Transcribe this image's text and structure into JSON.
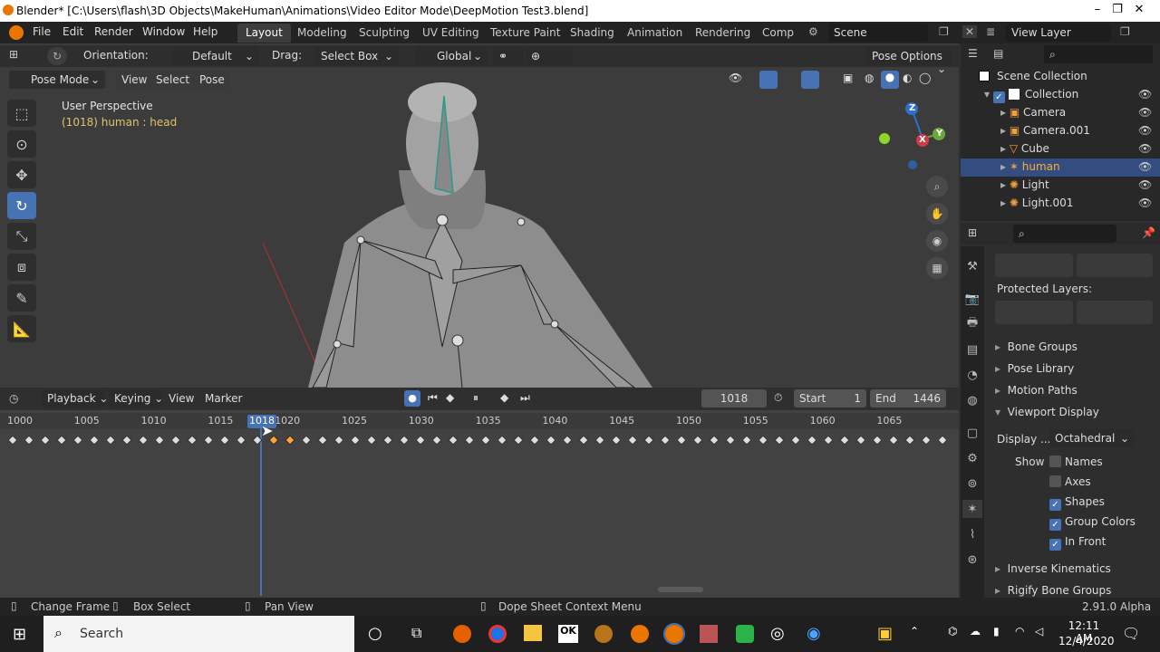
{
  "title": "Blender* [C:\\Users\\flash\\3D Objects\\MakeHuman\\Animations\\Video Editor Mode\\DeepMotion Test3.blend]",
  "window_controls": {
    "minimize": "–",
    "maximize": "❐",
    "close": "✕"
  },
  "menu": [
    "File",
    "Edit",
    "Render",
    "Window",
    "Help"
  ],
  "workspaces": [
    "Layout",
    "Modeling",
    "Sculpting",
    "UV Editing",
    "Texture Paint",
    "Shading",
    "Animation",
    "Rendering",
    "Comp"
  ],
  "scene": "Scene",
  "view_layer": "View Layer",
  "header": {
    "orientation_label": "Orientation:",
    "orientation": "Default",
    "drag_label": "Drag:",
    "drag": "Select Box",
    "transform": "Global",
    "pose_options": "Pose Options"
  },
  "viewport_header": {
    "mode": "Pose Mode",
    "view": "View",
    "select": "Select",
    "pose": "Pose"
  },
  "viewport": {
    "perspective": "User Perspective",
    "object": "(1018) human : head"
  },
  "gizmo": {
    "x": "X",
    "y": "Y",
    "z": "Z"
  },
  "timeline": {
    "playback": "Playback",
    "keying": "Keying",
    "view": "View",
    "marker": "Marker",
    "current_frame": "1018",
    "start_label": "Start",
    "start": "1",
    "end_label": "End",
    "end": "1446",
    "ticks": [
      "1000",
      "1005",
      "1010",
      "1015",
      "1020",
      "1025",
      "1030",
      "1035",
      "1040",
      "1045",
      "1050",
      "1055",
      "1060",
      "1065"
    ],
    "playhead": "1018"
  },
  "status": {
    "change_frame": "Change Frame",
    "box_select": "Box Select",
    "pan_view": "Pan View",
    "context_menu": "Dope Sheet Context Menu",
    "version": "2.91.0 Alpha"
  },
  "outliner": {
    "scene_collection": "Scene Collection",
    "collection": "Collection",
    "items": [
      "Camera",
      "Camera.001",
      "Cube",
      "human",
      "Light",
      "Light.001"
    ]
  },
  "properties": {
    "protected_layers": "Protected Layers:",
    "bone_groups": "Bone Groups",
    "pose_library": "Pose Library",
    "motion_paths": "Motion Paths",
    "viewport_display": "Viewport Display",
    "display_as_label": "Display ...",
    "display_as": "Octahedral",
    "show_label": "Show",
    "names": "Names",
    "axes": "Axes",
    "shapes": "Shapes",
    "group_colors": "Group Colors",
    "in_front": "In Front",
    "inverse_kinematics": "Inverse Kinematics",
    "rigify_bone_groups": "Rigify Bone Groups"
  },
  "taskbar": {
    "search": "Search",
    "time": "12:11 AM",
    "date": "12/4/2020"
  },
  "colors": {
    "accent": "#4772b3",
    "selected_key": "#ffa33a",
    "playhead": "#4772b3"
  }
}
